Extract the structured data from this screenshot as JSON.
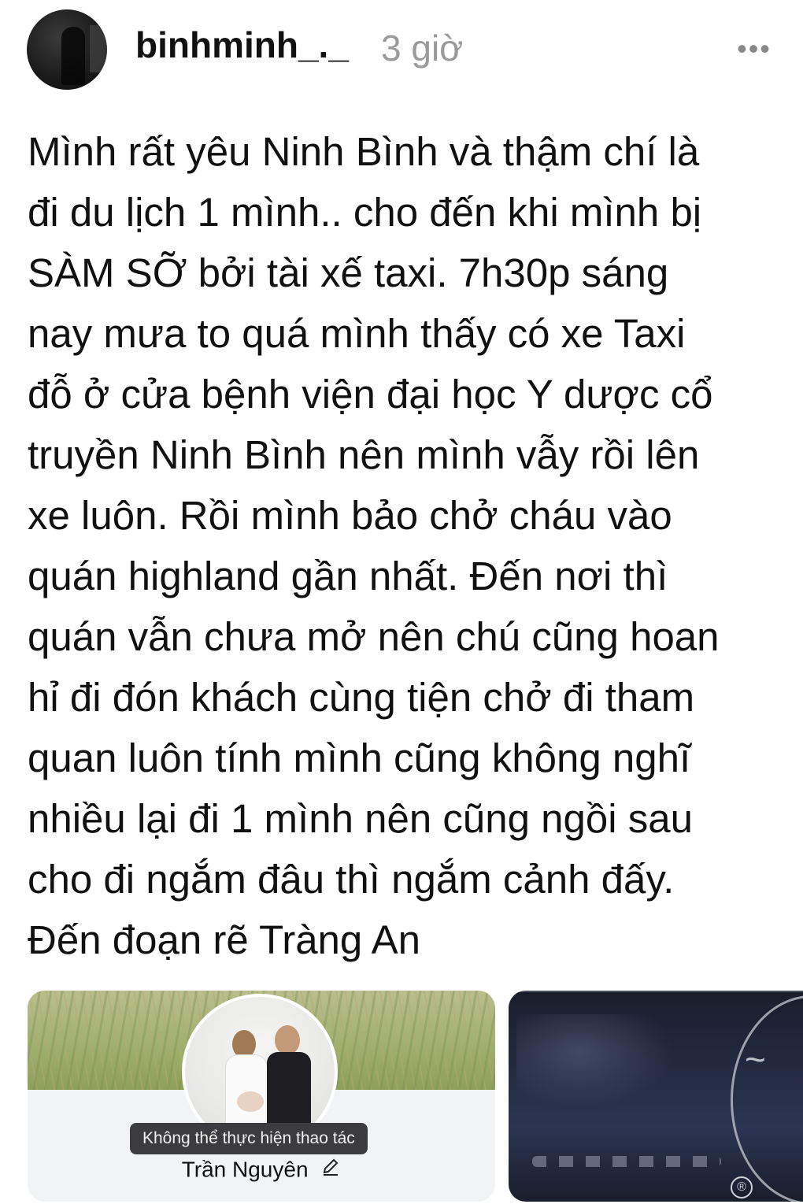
{
  "post": {
    "author": {
      "username": "binhminh_._",
      "time_ago": "3 giờ"
    },
    "more_icon": "more-horizontal-icon",
    "text": "Mình rất yêu Ninh Bình và thậm chí là\nđi du lịch 1 mình.. cho đến khi mình bị\nSÀM SỠ bởi tài xế taxi. 7h30p sáng\nnay mưa to quá mình thấy có xe Taxi\nđỗ ở cửa bệnh viện đại học Y dược cổ\ntruyền Ninh Bình nên mình vẫy rồi lên\nxe luôn. Rồi mình bảo chở cháu vào\nquán highland gần nhất. Đến nơi thì\nquán vẫn chưa mở nên chú cũng hoan\nhỉ đi đón khách cùng tiện chở đi tham\nquan luôn tính mình cũng không nghĩ\nnhiều lại đi 1 mình nên cũng ngồi sau\ncho đi ngắm đâu thì ngắm cảnh đấy.\nĐến đoạn rẽ Tràng An"
  },
  "attachments": {
    "profile_card": {
      "toast": "Không thể thực hiện thao tác",
      "name": "Trần Nguyên",
      "edit_icon": "pencil-icon"
    },
    "photo": {
      "registered_mark": "®"
    }
  },
  "colors": {
    "text": "#111111",
    "muted": "#9a9a9a",
    "toast_bg": "#3c3c3e"
  }
}
